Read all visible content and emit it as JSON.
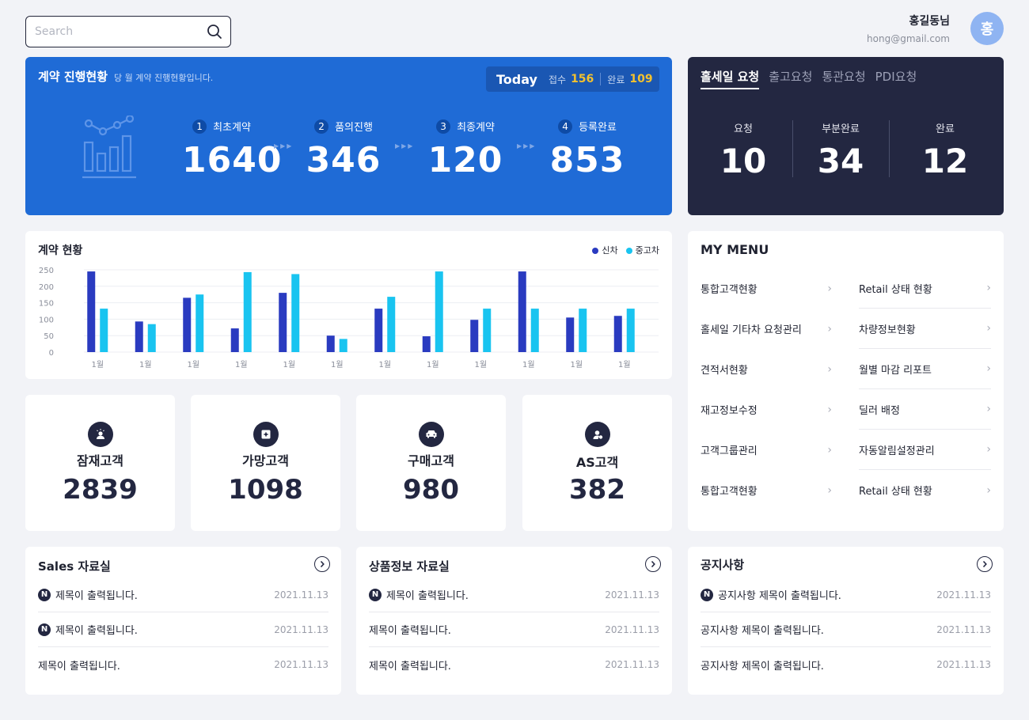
{
  "search": {
    "placeholder": "Search",
    "icon": "search-icon"
  },
  "user": {
    "name": "홍길동님",
    "email": "hong@gmail.com",
    "avatar": "홍"
  },
  "contract_panel": {
    "title": "계약 진행현황",
    "subtitle": "당 월 계약 진행현황입니다.",
    "today": {
      "label": "Today",
      "received_label": "접수",
      "received": "156",
      "done_label": "완료",
      "done": "109"
    },
    "steps": [
      {
        "num": "1",
        "label": "최초계약",
        "value": "1640"
      },
      {
        "num": "2",
        "label": "품의진행",
        "value": "346"
      },
      {
        "num": "3",
        "label": "최종계약",
        "value": "120"
      },
      {
        "num": "4",
        "label": "등록완료",
        "value": "853"
      }
    ],
    "arrows": "▶▶▶"
  },
  "request_panel": {
    "tabs": [
      "홀세일 요청",
      "출고요청",
      "통관요청",
      "PDI요청"
    ],
    "active_tab": 0,
    "columns": [
      {
        "label": "요청",
        "value": "10"
      },
      {
        "label": "부분완료",
        "value": "34"
      },
      {
        "label": "완료",
        "value": "12"
      }
    ]
  },
  "chart_card": {
    "title": "계약 현황",
    "legend": [
      "신차",
      "중고차"
    ]
  },
  "chart_data": {
    "type": "bar",
    "title": "계약 현황",
    "categories": [
      "1월",
      "1월",
      "1월",
      "1월",
      "1월",
      "1월",
      "1월",
      "1월",
      "1월",
      "1월",
      "1월",
      "1월"
    ],
    "series": [
      {
        "name": "신차",
        "color": "#2a3bc0",
        "values": [
          245,
          93,
          165,
          72,
          180,
          50,
          132,
          48,
          98,
          245,
          105,
          110
        ]
      },
      {
        "name": "중고차",
        "color": "#19c4f0",
        "values": [
          132,
          85,
          175,
          243,
          237,
          40,
          168,
          245,
          132,
          132,
          132,
          132
        ]
      }
    ],
    "ylim": [
      0,
      250
    ],
    "yticks": [
      "0",
      "50",
      "100",
      "150",
      "200",
      "250"
    ],
    "grid": true,
    "legend_position": "top-right"
  },
  "stats": [
    {
      "label": "잠재고객",
      "value": "2839",
      "icon": "person-sun-icon"
    },
    {
      "label": "가망고객",
      "value": "1098",
      "icon": "sparkle-card-icon"
    },
    {
      "label": "구매고객",
      "value": "980",
      "icon": "car-icon"
    },
    {
      "label": "AS고객",
      "value": "382",
      "icon": "person-badge-icon"
    }
  ],
  "my_menu": {
    "title": "MY MENU",
    "rows": [
      [
        "통합고객현황",
        "Retail 상태 현황"
      ],
      [
        "홀세일 기타차 요청관리",
        "차량정보현황"
      ],
      [
        "견적서현황",
        "월별 마감 리포트"
      ],
      [
        "재고정보수정",
        "딜러 배정"
      ],
      [
        "고객그룹관리",
        "자동알림설정관리"
      ],
      [
        "통합고객현황",
        "Retail 상태 현황"
      ]
    ]
  },
  "lists": [
    {
      "title": "Sales 자료실",
      "items": [
        {
          "new": true,
          "text": "제목이 출력됩니다.",
          "date": "2021.11.13"
        },
        {
          "new": true,
          "text": "제목이 출력됩니다.",
          "date": "2021.11.13"
        },
        {
          "new": false,
          "text": "제목이 출력됩니다.",
          "date": "2021.11.13"
        }
      ]
    },
    {
      "title": "상품정보 자료실",
      "items": [
        {
          "new": true,
          "text": "제목이 출력됩니다.",
          "date": "2021.11.13"
        },
        {
          "new": false,
          "text": "제목이 출력됩니다.",
          "date": "2021.11.13"
        },
        {
          "new": false,
          "text": "제목이 출력됩니다.",
          "date": "2021.11.13"
        }
      ]
    },
    {
      "title": "공지사항",
      "items": [
        {
          "new": true,
          "text": "공지사항 제목이 출력됩니다.",
          "date": "2021.11.13"
        },
        {
          "new": false,
          "text": "공지사항 제목이 출력됩니다.",
          "date": "2021.11.13"
        },
        {
          "new": false,
          "text": "공지사항 제목이 출력됩니다.",
          "date": "2021.11.13"
        }
      ]
    }
  ],
  "new_badge": "N"
}
